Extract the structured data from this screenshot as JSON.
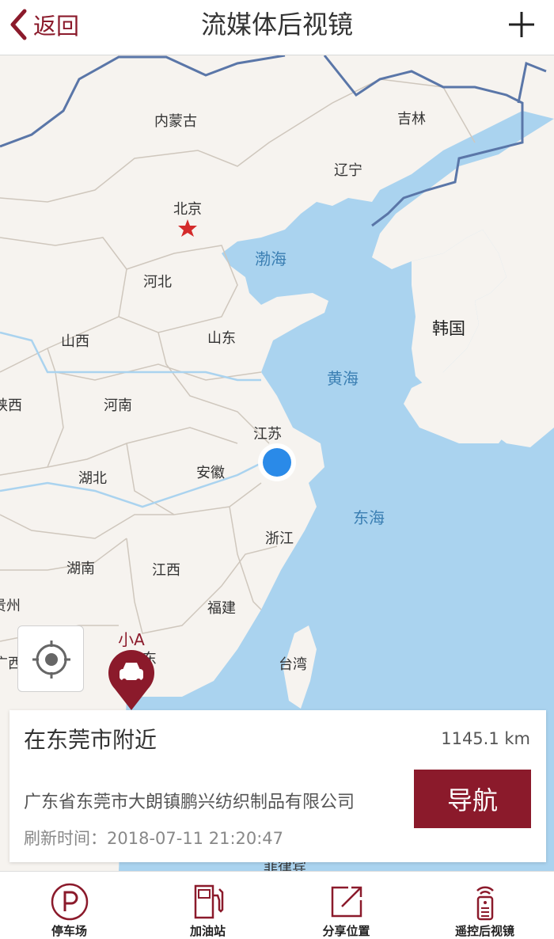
{
  "header": {
    "back_label": "返回",
    "title": "流媒体后视镜"
  },
  "colors": {
    "brand": "#8b1a2b",
    "water": "#aad3ef",
    "land": "#f6f3ef",
    "border": "#5a76a8",
    "dot": "#2a8ae8"
  },
  "map": {
    "provinces": [
      "内蒙古",
      "吉林",
      "辽宁",
      "北京",
      "河北",
      "山西",
      "山东",
      "陕西",
      "河南",
      "江苏",
      "安徽",
      "湖北",
      "浙江",
      "湖南",
      "江西",
      "贵州",
      "福建",
      "广西",
      "广东",
      "台湾",
      "菲律宾"
    ],
    "seas": [
      "渤海",
      "黄海",
      "东海"
    ],
    "country": "韩国",
    "vehicle_label": "小A"
  },
  "info": {
    "location_title": "在东莞市附近",
    "distance": "1145.1 km",
    "address": "广东省东莞市大朗镇鹏兴纺织制品有限公司",
    "refresh_label": "刷新时间：",
    "refresh_time": "2018-07-11 21:20:47",
    "nav_label": "导航"
  },
  "tabs": [
    {
      "label": "停车场",
      "icon": "parking-icon"
    },
    {
      "label": "加油站",
      "icon": "gas-station-icon"
    },
    {
      "label": "分享位置",
      "icon": "share-icon"
    },
    {
      "label": "遥控后视镜",
      "icon": "remote-icon"
    }
  ]
}
